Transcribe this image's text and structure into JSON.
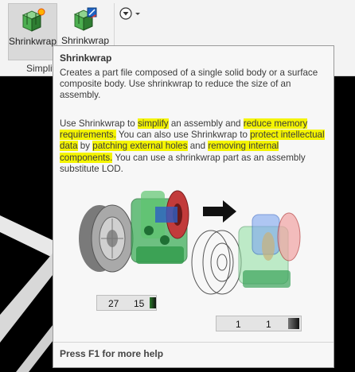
{
  "ribbon": {
    "buttons": [
      {
        "label": "Shrinkwrap",
        "icon": "shrinkwrap-icon",
        "active": true
      },
      {
        "label": "Shrinkwrap",
        "icon": "shrinkwrap-substitute-icon",
        "active": false
      }
    ],
    "group_label": "Simplif",
    "dropdown_icon": "navigation-dropdown-icon"
  },
  "tooltip": {
    "title": "Shrinkwrap",
    "paragraph1": "Creates a part file composed of a single solid body or a surface composite body. Use shrinkwrap to reduce the size of an assembly.",
    "p2": {
      "t1": "Use Shrinkwrap to ",
      "h1": "simplify",
      "t2": " an assembly and ",
      "h2": "reduce memory requirements.",
      "t3": " You can also use Shrinkwrap to ",
      "h3": "protect intellectual data",
      "t4": " by ",
      "h4": "patching external holes",
      "t5": " and ",
      "h5": "removing internal components.",
      "t6": " You can use a shrinkwrap part as an assembly substitute LOD."
    },
    "figure": {
      "before_counts": [
        "27",
        "15"
      ],
      "after_counts": [
        "1",
        "1"
      ],
      "arrow_icon": "right-arrow-icon"
    },
    "footer": "Press F1 for more help"
  },
  "colors": {
    "highlight": "#f4f400",
    "tooltip_bg": "#f7f7f7",
    "ribbon_bg": "#f3f3f3"
  }
}
